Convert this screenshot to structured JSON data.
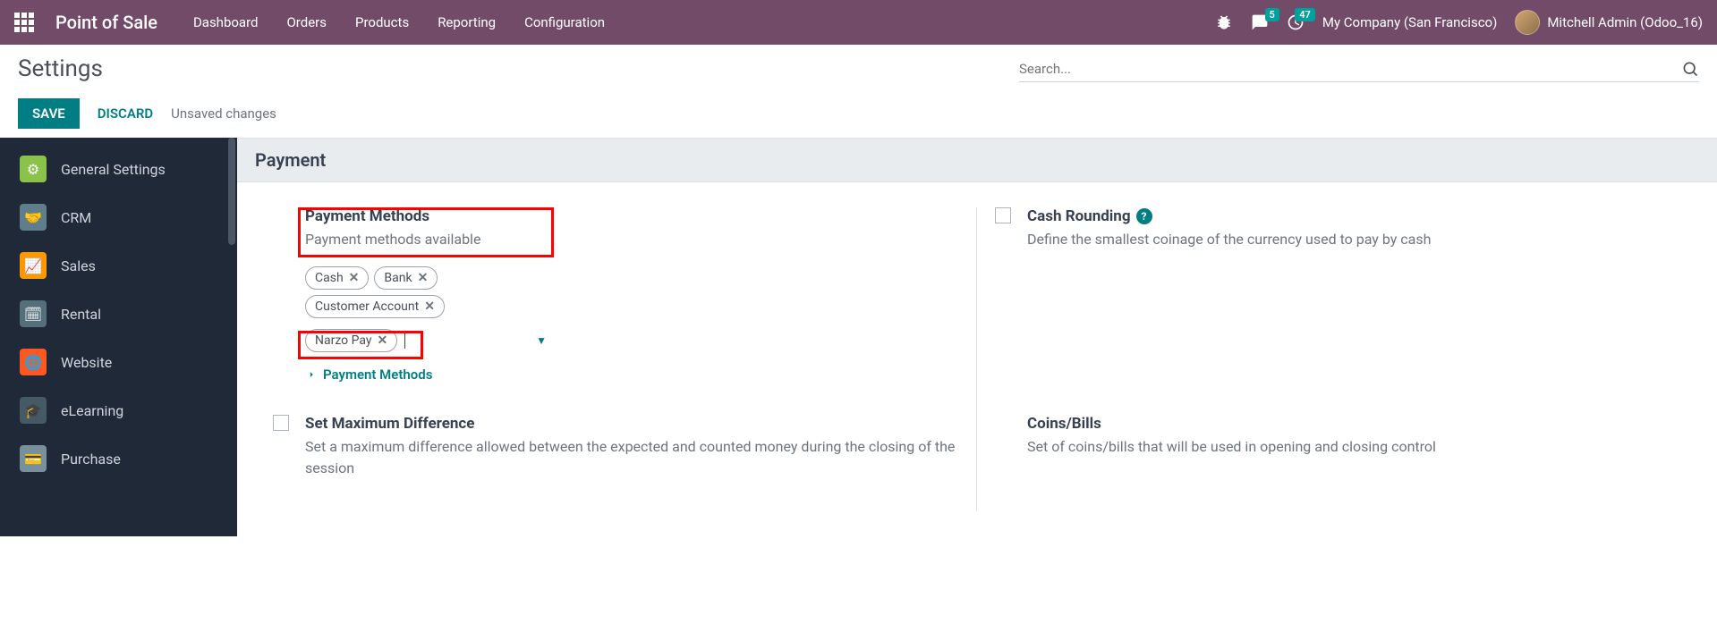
{
  "navbar": {
    "brand": "Point of Sale",
    "menu": [
      "Dashboard",
      "Orders",
      "Products",
      "Reporting",
      "Configuration"
    ],
    "messages_badge": "5",
    "activities_badge": "47",
    "company": "My Company (San Francisco)",
    "user": "Mitchell Admin (Odoo_16)"
  },
  "control_panel": {
    "title": "Settings",
    "search_placeholder": "Search...",
    "save_label": "SAVE",
    "discard_label": "DISCARD",
    "unsaved_label": "Unsaved changes"
  },
  "sidebar": {
    "items": [
      {
        "label": "General Settings"
      },
      {
        "label": "CRM"
      },
      {
        "label": "Sales"
      },
      {
        "label": "Rental"
      },
      {
        "label": "Website"
      },
      {
        "label": "eLearning"
      },
      {
        "label": "Purchase"
      }
    ]
  },
  "section": {
    "header": "Payment"
  },
  "settings": {
    "payment_methods": {
      "title": "Payment Methods",
      "desc": "Payment methods available",
      "tags": [
        "Cash",
        "Bank",
        "Customer Account",
        "Narzo Pay"
      ],
      "link": "Payment Methods"
    },
    "cash_rounding": {
      "title": "Cash Rounding",
      "desc": "Define the smallest coinage of the currency used to pay by cash"
    },
    "max_diff": {
      "title": "Set Maximum Difference",
      "desc": "Set a maximum difference allowed between the expected and counted money during the closing of the session"
    },
    "coins_bills": {
      "title": "Coins/Bills",
      "desc": "Set of coins/bills that will be used in opening and closing control"
    }
  }
}
